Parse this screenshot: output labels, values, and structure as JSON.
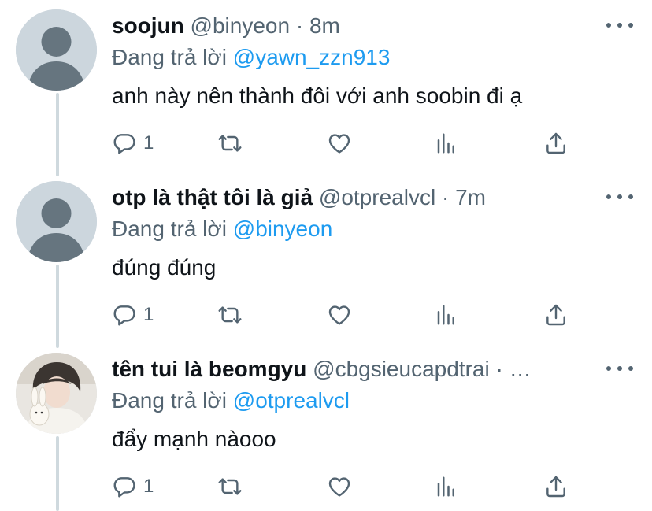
{
  "tweets": [
    {
      "name": "soojun",
      "handle": "@binyeon",
      "separator": "·",
      "time": "8m",
      "reply_prefix": "Đang trả lời ",
      "reply_to": "@yawn_zzn913",
      "text": "anh này nên thành đôi với anh soobin đi ạ",
      "reply_count": "1",
      "avatar": "default-avatar"
    },
    {
      "name": "otp là thật tôi là giả",
      "handle": "@otprealvcl",
      "separator": "·",
      "time": "7m",
      "reply_prefix": "Đang trả lời ",
      "reply_to": "@binyeon",
      "text": "đúng đúng",
      "reply_count": "1",
      "avatar": "default-avatar"
    },
    {
      "name": "tên tui là beomgyu",
      "handle": "@cbgsieucapdtrai",
      "separator": "·",
      "time": "…",
      "reply_prefix": "Đang trả lời ",
      "reply_to": "@otprealvcl",
      "text": "đẩy mạnh nàooo",
      "reply_count": "1",
      "avatar": "photo-avatar"
    }
  ],
  "colors": {
    "text": "#0f1419",
    "secondary": "#536471",
    "link": "#1d9bf0",
    "thread_line": "#cfd9de"
  }
}
